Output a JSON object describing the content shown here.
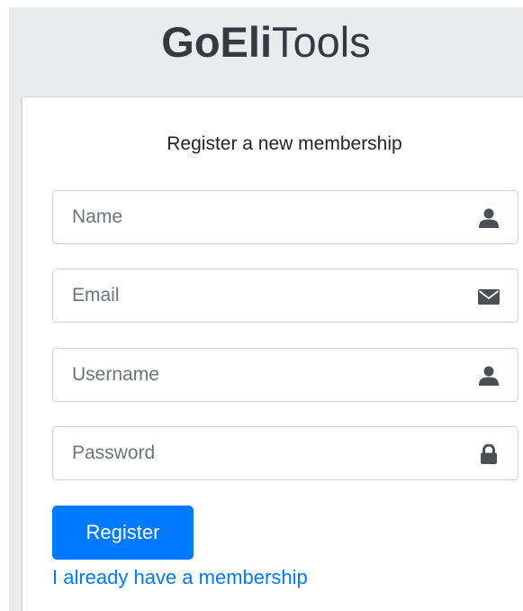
{
  "logo": {
    "bold": "GoEli",
    "light": "Tools"
  },
  "card": {
    "subtitle": "Register a new membership"
  },
  "fields": {
    "name": {
      "placeholder": "Name",
      "icon": "user-icon"
    },
    "email": {
      "placeholder": "Email",
      "icon": "envelope-icon"
    },
    "username": {
      "placeholder": "Username",
      "icon": "user-icon"
    },
    "password": {
      "placeholder": "Password",
      "icon": "lock-icon"
    }
  },
  "actions": {
    "register_label": "Register",
    "membership_link": "I already have a membership"
  },
  "colors": {
    "primary": "#007bff",
    "page_background": "#e9ecef",
    "icon": "#495057"
  }
}
